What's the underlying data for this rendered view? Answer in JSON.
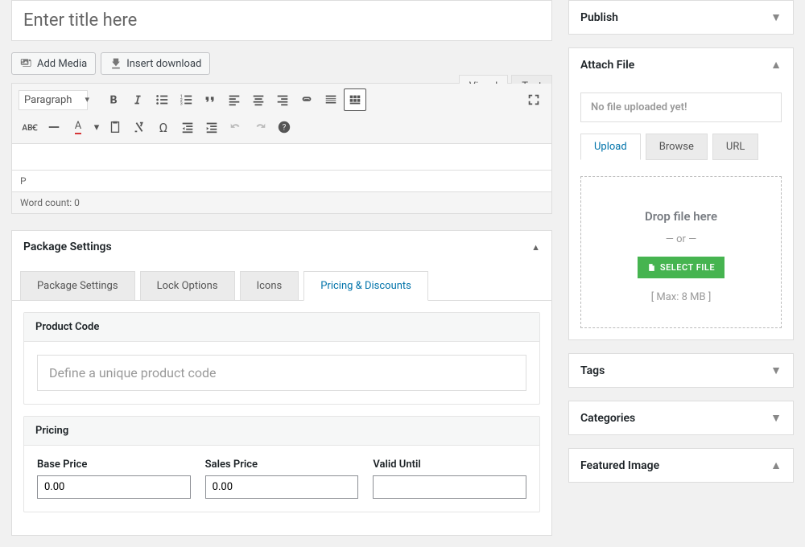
{
  "title": {
    "placeholder": "Enter title here"
  },
  "editor": {
    "add_media": "Add Media",
    "insert_download": "Insert download",
    "tabs": {
      "visual": "Visual",
      "text": "Text"
    },
    "paragraph": "Paragraph",
    "status_element": "P",
    "word_count": "Word count: 0"
  },
  "package": {
    "title": "Package Settings",
    "tabs": {
      "settings": "Package Settings",
      "lock": "Lock Options",
      "icons": "Icons",
      "pricing": "Pricing & Discounts"
    },
    "product_code": {
      "label": "Product Code",
      "placeholder": "Define a unique product code"
    },
    "pricing": {
      "label": "Pricing",
      "base_price": {
        "label": "Base Price",
        "value": "0.00"
      },
      "sales_price": {
        "label": "Sales Price",
        "value": "0.00"
      },
      "valid_until": {
        "label": "Valid Until",
        "value": ""
      }
    }
  },
  "sidebar": {
    "publish": "Publish",
    "attach": {
      "title": "Attach File",
      "no_file": "No file uploaded yet!",
      "tabs": {
        "upload": "Upload",
        "browse": "Browse",
        "url": "URL"
      },
      "drop_title": "Drop file here",
      "or": "—  or  —",
      "select": "SELECT FILE",
      "max": "[ Max: 8 MB ]"
    },
    "tags": "Tags",
    "categories": "Categories",
    "featured": "Featured Image"
  }
}
